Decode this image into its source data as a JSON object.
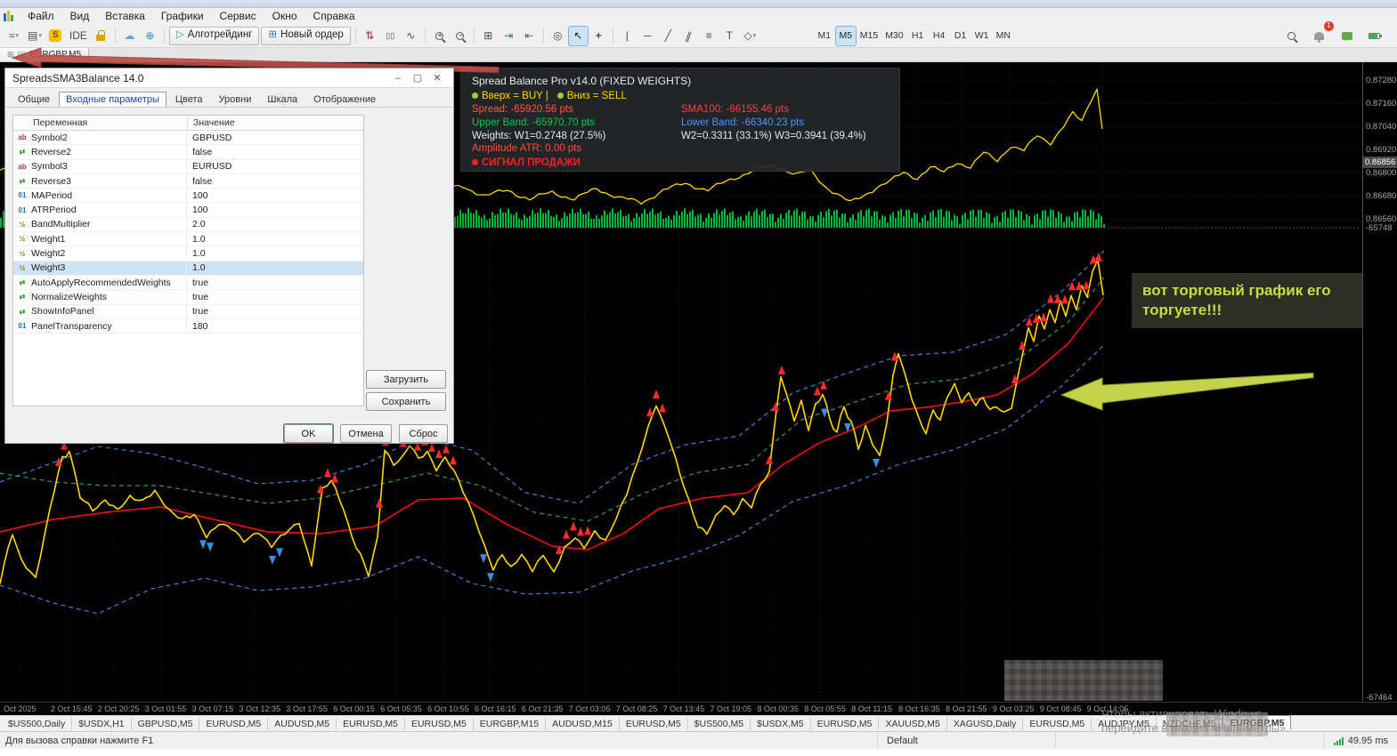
{
  "menu": {
    "items": [
      "Файл",
      "Вид",
      "Вставка",
      "Графики",
      "Сервис",
      "Окно",
      "Справка"
    ]
  },
  "toolbar": {
    "ide_label": "IDE",
    "algo_label": "Алготрейдинг",
    "new_order_label": "Новый ордер",
    "timeframes": [
      "M1",
      "M5",
      "M15",
      "M30",
      "H1",
      "H4",
      "D1",
      "W1",
      "MN"
    ],
    "active_timeframe": "M5",
    "notification_count": "1"
  },
  "glyphs": {
    "chart_line": "≈",
    "caret": "▾",
    "profile": "▤",
    "dollar": "S",
    "cloud": "☁",
    "globe": "⊕",
    "play": "▷",
    "updown": "⇅",
    "candles": "▯▯",
    "line": "∿",
    "grid": "⊞",
    "shift_end": "⇥",
    "shift_auto": "⇤",
    "snapshot": "◎",
    "cursor": "↖",
    "crosshair": "+",
    "vline": "|",
    "hline": "─",
    "trend": "╱",
    "channel": "∥",
    "fibo": "≡",
    "text": "T",
    "shapes": "◇"
  },
  "chart_tab": {
    "label": "EURGBP,M5"
  },
  "dialog": {
    "title": "SpreadsSMA3Balance 14.0",
    "controls": {
      "minimize": "–",
      "maximize": "▢",
      "close": "✕"
    },
    "tabs": [
      "Общие",
      "Входные параметры",
      "Цвета",
      "Уровни",
      "Шкала",
      "Отображение"
    ],
    "active_tab": "Входные параметры",
    "table": {
      "headers": [
        "Переменная",
        "Значение"
      ],
      "rows": [
        {
          "type": "string",
          "name": "Symbol2",
          "value": "GBPUSD"
        },
        {
          "type": "bool",
          "name": "Reverse2",
          "value": "false"
        },
        {
          "type": "string",
          "name": "Symbol3",
          "value": "EURUSD"
        },
        {
          "type": "bool",
          "name": "Reverse3",
          "value": "false"
        },
        {
          "type": "int",
          "name": "MAPeriod",
          "value": "100"
        },
        {
          "type": "int",
          "name": "ATRPeriod",
          "value": "100"
        },
        {
          "type": "double",
          "name": "BandMultiplier",
          "value": "2.0"
        },
        {
          "type": "double",
          "name": "Weight1",
          "value": "1.0"
        },
        {
          "type": "double",
          "name": "Weight2",
          "value": "1.0"
        },
        {
          "type": "double",
          "name": "Weight3",
          "value": "1.0",
          "selected": true
        },
        {
          "type": "bool",
          "name": "AutoApplyRecommendedWeights",
          "value": "true"
        },
        {
          "type": "bool",
          "name": "NormalizeWeights",
          "value": "true"
        },
        {
          "type": "bool",
          "name": "ShowInfoPanel",
          "value": "true"
        },
        {
          "type": "int",
          "name": "PanelTransparency",
          "value": "180"
        }
      ]
    },
    "buttons": {
      "load": "Загрузить",
      "save": "Сохранить",
      "ok": "OK",
      "cancel": "Отмена",
      "reset": "Сброс"
    }
  },
  "info_panel": {
    "title": "Spread Balance Pro v14.0 (FIXED WEIGHTS)",
    "up_label": "Вверх = BUY |",
    "down_label": "Вниз = SELL",
    "spread": "Spread: -65920.56 pts",
    "sma": "SMA100: -66155.46 pts",
    "upper_band": "Upper Band: -65970.70 pts",
    "lower_band": "Lower Band: -66340.23 pts",
    "weights_left": "Weights: W1=0.2748 (27.5%)",
    "weights_right": "W2=0.3311 (33.1%) W3=0.3941 (39.4%)",
    "amplitude": "Amplitude ATR: 0.00 pts",
    "signal": "СИГНАЛ ПРОДАЖИ"
  },
  "annotation": {
    "line1": "вот торговый график его",
    "line2": "торгуете!!!"
  },
  "chart": {
    "price_ticks": [
      "0.87280",
      "0.87160",
      "0.87040",
      "0.86920",
      "0.86800",
      "0.86680",
      "0.86560"
    ],
    "current_price": "0.86856",
    "mid_level": "-65748",
    "bottom_level": "-67464",
    "time_ticks": [
      "Oct 2025",
      "2 Oct 15:45",
      "2 Oct 20:25",
      "3 Oct 01:55",
      "3 Oct 07:15",
      "3 Oct 12:35",
      "3 Oct 17:55",
      "6 Oct 00:15",
      "6 Oct 05:35",
      "6 Oct 10:55",
      "6 Oct 16:15",
      "6 Oct 21:35",
      "7 Oct 03:05",
      "7 Oct 08:25",
      "7 Oct 13:45",
      "7 Oct 19:05",
      "8 Oct 00:35",
      "8 Oct 05:55",
      "8 Oct 11:15",
      "8 Oct 16:35",
      "8 Oct 21:55",
      "9 Oct 03:25",
      "9 Oct 08:45",
      "9 Oct 14:05"
    ]
  },
  "bottom_tabs": {
    "items": [
      "$US500,Daily",
      "$USDX,H1",
      "GBPUSD,M5",
      "EURUSD,M5",
      "AUDUSD,M5",
      "EURUSD,M5",
      "EURUSD,M5",
      "EURGBP,M15",
      "AUDUSD,M15",
      "EURUSD,M5",
      "$US500,M5",
      "$USDX,M5",
      "EURUSD,M5",
      "XAUUSD,M5",
      "XAGUSD,Daily",
      "EURUSD,M5",
      "AUDJPY,M5",
      "NZDCHF,M5",
      "EURGBP,M5"
    ],
    "active_index": 18
  },
  "status_bar": {
    "help_text": "Для вызова справки нажмите F1",
    "profile": "Default",
    "ping": "49.95 ms"
  },
  "watermark": {
    "line1": "Чтобы активировать Windows",
    "line2": "перейдите в раздел «Параметры»."
  },
  "colors": {
    "price_line": "#ffd800",
    "sma_line": "#e01010",
    "band_blue": "#3f7fd6",
    "band_green": "#2f9e44",
    "volume": "#04b43c",
    "sell_arrow": "#ff2a2a",
    "buy_arrow": "#3b8de0",
    "accent": "#cfe3f7",
    "annotation_text": "#cadd3e"
  }
}
